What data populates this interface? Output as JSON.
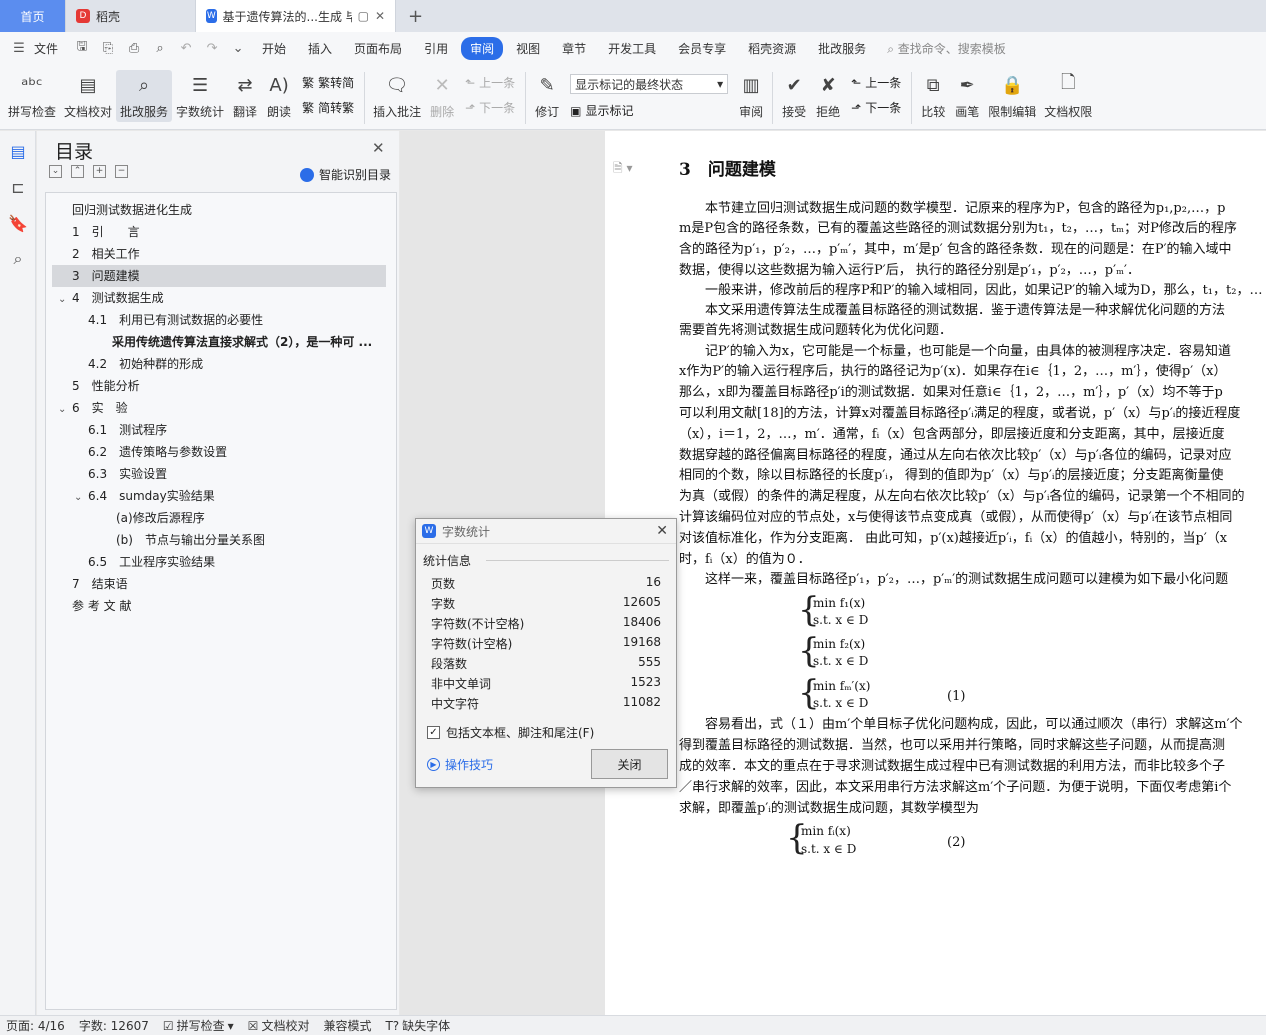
{
  "tabs": {
    "home": "首页",
    "daoke": "稻壳",
    "doc": "基于遗传算法的...生成 毕业论文",
    "new_tab": "+"
  },
  "menu": {
    "file": "文件",
    "items": [
      "开始",
      "插入",
      "页面布局",
      "引用",
      "审阅",
      "视图",
      "章节",
      "开发工具",
      "会员专享",
      "稻壳资源",
      "批改服务"
    ],
    "active_index": 4,
    "search": "查找命令、搜索模板"
  },
  "ribbon": {
    "spell": "拼写检查",
    "proof": "文档校对",
    "review_service": "批改服务",
    "word_count": "字数统计",
    "translate": "翻译",
    "read_aloud": "朗读",
    "trad": "繁转简",
    "simp": "简转繁",
    "insert_comment": "插入批注",
    "delete": "删除",
    "prev1": "上一条",
    "next1": "下一条",
    "track": "修订",
    "show_mode": "显示标记的最终状态",
    "show_marks": "显示标记",
    "review": "审阅",
    "accept": "接受",
    "reject": "拒绝",
    "prev2": "上一条",
    "next2": "下一条",
    "compare": "比较",
    "pen": "画笔",
    "restrict": "限制编辑",
    "rights": "文档权限"
  },
  "toc": {
    "title": "目录",
    "smart": "智能识别目录",
    "items": [
      "回归测试数据进化生成",
      "1　引　　言",
      "2　相关工作",
      "3　问题建模",
      "4　测试数据生成",
      "4.1　利用已有测试数据的必要性",
      "采用传统遗传算法直接求解式（2），是一种可 ...",
      "4.2　初始种群的形成",
      "5　性能分析",
      "6　实　验",
      "6.1　测试程序",
      "6.2　遗传策略与参数设置",
      "6.3　实验设置",
      "6.4　sumday实验结果",
      "(a)修改后源程序",
      "(b)　节点与输出分量关系图",
      "6.5　工业程序实验结果",
      "7　结束语",
      "参 考 文 献"
    ],
    "selected_index": 3
  },
  "dialog": {
    "title": "字数统计",
    "section": "统计信息",
    "rows": [
      {
        "label": "页数",
        "value": "16"
      },
      {
        "label": "字数",
        "value": "12605"
      },
      {
        "label": "字符数(不计空格)",
        "value": "18406"
      },
      {
        "label": "字符数(计空格)",
        "value": "19168"
      },
      {
        "label": "段落数",
        "value": "555"
      },
      {
        "label": "非中文单词",
        "value": "1523"
      },
      {
        "label": "中文字符",
        "value": "11082"
      }
    ],
    "include": "包括文本框、脚注和尾注(F)",
    "tips": "操作技巧",
    "close": "关闭"
  },
  "document": {
    "heading": "3　问题建模",
    "lines": [
      "　　本节建立回归测试数据生成问题的数学模型．记原来的程序为P，包含的路径为p₁,p₂,…，p",
      "m是P包含的路径条数，已有的覆盖这些路径的测试数据分别为t₁，t₂，…，tₘ；对P修改后的程序",
      "含的路径为p′₁，p′₂，…，p′ₘ′，其中，m′是p′ 包含的路径条数．现在的问题是：在P′的输入域中",
      "数据，使得以这些数据为输入运行P′后， 执行的路径分别是p′₁，p′₂，…，p′ₘ′．",
      "　　一般来讲，修改前后的程序P和P′的输入域相同，因此，如果记P′的输入域为D，那么，t₁，t₂，…",
      "　　本文采用遗传算法生成覆盖目标路径的测试数据．鉴于遗传算法是一种求解优化问题的方法",
      "需要首先将测试数据生成问题转化为优化问题．",
      "　　记P′的输入为x，它可能是一个标量，也可能是一个向量，由具体的被测程序决定．容易知道",
      "x作为P′的输入运行程序后，执行的路径记为p′(x)．如果存在i∈｛1，2，…，m′｝，使得p′（x）",
      "那么，x即为覆盖目标路径p′i的测试数据．如果对任意i∈｛1，2，…，m′｝，p′（x）均不等于p",
      "可以利用文献[18]的方法，计算x对覆盖目标路径p′ᵢ满足的程度，或者说，p′（x）与p′ᵢ的接近程度",
      "（x），i＝1，2，…，m′．通常，fᵢ（x）包含两部分，即层接近度和分支距离，其中，层接近度",
      "数据穿越的路径偏离目标路径的程度，通过从左向右依次比较p′（x）与p′ᵢ各位的编码，记录对应",
      "相同的个数，除以目标路径的长度p′ᵢ， 得到的值即为p′（x）与p′ᵢ的层接近度；分支距离衡量使",
      "为真（或假）的条件的满足程度，从左向右依次比较p′（x）与p′ᵢ各位的编码，记录第一个不相同的",
      "计算该编码位对应的节点处，x与使得该节点变成真（或假），从而使得p′（x）与p′ᵢ在该节点相同",
      "对该值标准化，作为分支距离． 由此可知，p′(x)越接近p′ᵢ，fᵢ（x）的值越小，特别的，当p′（x",
      "时，fᵢ（x）的值为０．",
      "　　这样一来，覆盖目标路径p′₁，p′₂，…，p′ₘ′的测试数据生成问题可以建模为如下最小化问题"
    ],
    "eq1": [
      [
        "min  f₁(x)",
        "s.t.  x ∈ D"
      ],
      [
        "min  f₂(x)",
        "s.t.  x ∈ D"
      ],
      [
        "min  fₘ′(x)",
        "s.t.  x ∈ D"
      ]
    ],
    "eq1_label": "(1)",
    "lines2": [
      "　　容易看出，式（１）由m′个单目标子优化问题构成，因此，可以通过顺次（串行）求解这m′个",
      "得到覆盖目标路径的测试数据．当然，也可以采用并行策略，同时求解这些子问题，从而提高测",
      "成的效率．本文的重点在于寻求测试数据生成过程中已有测试数据的利用方法，而非比较多个子",
      "／串行求解的效率，因此，本文采用串行方法求解这m′个子问题．为便于说明，下面仅考虑第i个",
      "求解，即覆盖p′ᵢ的测试数据生成问题，其数学模型为"
    ],
    "eq2": [
      "min  fᵢ(x)",
      "s.t.  x ∈ D"
    ],
    "eq2_label": "(2)"
  },
  "status": {
    "page": "页面: 4/16",
    "words": "字数: 12607",
    "spell": "拼写检查",
    "proof": "文档校对",
    "compat": "兼容模式",
    "missing_font": "缺失字体"
  }
}
